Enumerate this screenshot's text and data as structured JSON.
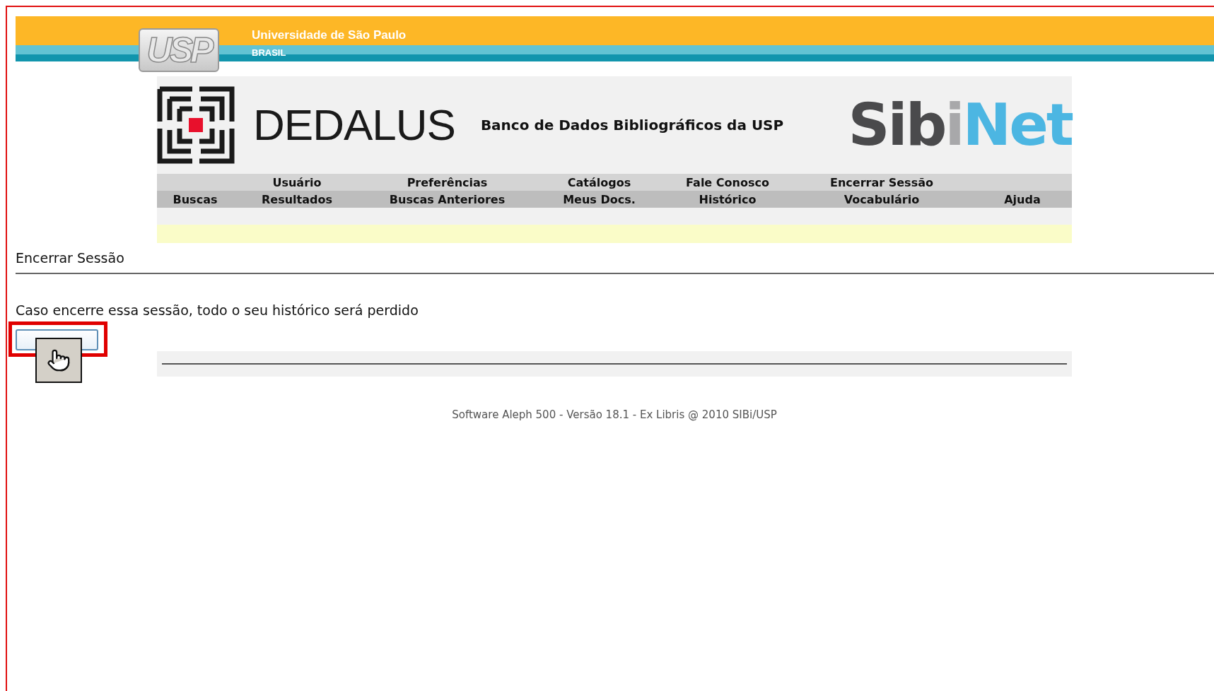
{
  "banner": {
    "logo_text": "USP",
    "title": "Universidade de São Paulo",
    "subtitle": "BRASIL"
  },
  "header": {
    "brand": "DEDALUS",
    "tagline": "Banco de Dados Bibliográficos da USP",
    "partner_logo": [
      {
        "text": "Sib",
        "color": "#4a4a4c"
      },
      {
        "text": "i",
        "color": "#a8a8aa"
      },
      {
        "text": "Net",
        "color": "#4cb6e2"
      }
    ]
  },
  "nav": [
    {
      "bottom": "Buscas"
    },
    {
      "top": "Usuário",
      "bottom": "Resultados"
    },
    {
      "top": "Preferências",
      "bottom": "Buscas Anteriores"
    },
    {
      "top": "Catálogos",
      "bottom": "Meus Docs."
    },
    {
      "top": "Fale Conosco",
      "bottom": "Histórico"
    },
    {
      "top": "Encerrar Sessão",
      "bottom": "Vocabulário"
    },
    {
      "bottom": "Ajuda"
    }
  ],
  "page": {
    "heading": "Encerrar Sessão",
    "message": "Caso encerre essa sessão, todo o seu histórico será perdido",
    "ok_button": {
      "highlighted": true
    }
  },
  "footer": "Software Aleph 500 - Versão 18.1 - Ex Libris @ 2010 SIBi/USP"
}
